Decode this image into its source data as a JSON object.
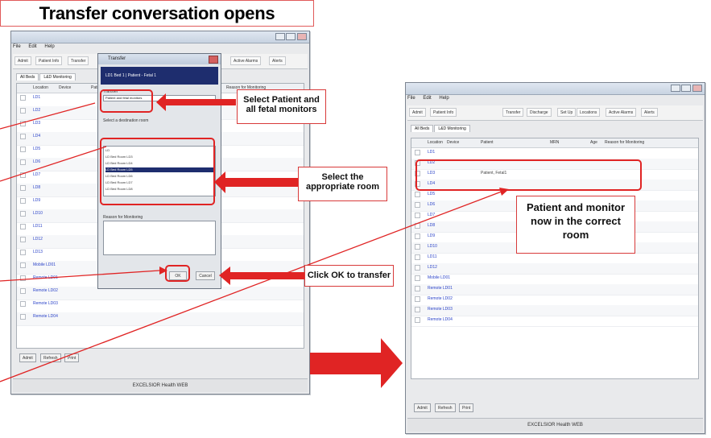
{
  "title": "Transfer conversation opens",
  "colors": {
    "accent": "#e02424",
    "arrow": "#e02424",
    "dialog_header": "#1e2d6e",
    "location_link": "#2b43c8"
  },
  "left_window": {
    "menu": [
      "File",
      "Edit",
      "Help"
    ],
    "toolbar": [
      "Admit",
      "Patient Info",
      "Transfer",
      "Discharge",
      "Set Up",
      "Locations",
      "Active Alarms",
      "Alerts"
    ],
    "tabs": [
      "All Beds",
      "L&D Monitoring",
      "All Units"
    ],
    "columns": [
      "Location",
      "Device",
      "Patient",
      "MRN",
      "Age",
      "Reason for Monitoring"
    ],
    "rows": [
      "LD1",
      "LD2",
      "LD3",
      "LD4",
      "LD5",
      "LD6",
      "LD7",
      "LD8",
      "LD9",
      "LD10",
      "LD11",
      "LD12",
      "LD13",
      "Mobile LD01",
      "Remote LD01",
      "Remote LD02",
      "Remote LD03",
      "Remote LD04"
    ],
    "bottom_buttons": [
      "Admit",
      "Refresh",
      "Print"
    ],
    "status": "EXCELSIOR Health WEB"
  },
  "dialog": {
    "title": "Transfer",
    "header": "LD1 Bed 1 | Patient - Fetal 1",
    "select_label": "Transfer",
    "radio_label": "Patient and fetal monitors",
    "room_label": "Select a destination room",
    "rooms": [
      "LD",
      "LD Bed Room LD3",
      "LD Bed Room LD4",
      "LD Bed Room LD5",
      "LD Bed Room LD6",
      "LD Bed Room LD7",
      "LD Bed Room LD8"
    ],
    "reason_label": "Reason for Monitoring",
    "ok_label": "OK",
    "cancel_label": "Cancel"
  },
  "callouts": {
    "select_patient": "Select Patient and all fetal monitors",
    "select_room": "Select the appropriate room",
    "click_ok": "Click OK to transfer",
    "result": "Patient and monitor now in the correct room"
  },
  "right_window": {
    "menu": [
      "File",
      "Edit",
      "Help"
    ],
    "toolbar": [
      "Admit",
      "Patient Info",
      "Transfer",
      "Discharge",
      "Set Up",
      "Locations",
      "Active Alarms",
      "Alerts"
    ],
    "tabs": [
      "All Beds",
      "L&D Monitoring",
      "All Units"
    ],
    "columns": [
      "Location",
      "Device",
      "Patient",
      "MRN",
      "Age",
      "Reason for Monitoring"
    ],
    "rows": [
      "LD1",
      "LD2",
      "LD3",
      "LD4",
      "LD5",
      "LD6",
      "LD7",
      "LD8",
      "LD9",
      "LD10",
      "LD11",
      "LD12",
      "Mobile LD01",
      "Remote LD01",
      "Remote LD02",
      "Remote LD03",
      "Remote LD04"
    ],
    "moved_row_patient": "Patient, Fetal1",
    "bottom_buttons": [
      "Admit",
      "Refresh",
      "Print"
    ],
    "status": "EXCELSIOR Health WEB"
  }
}
